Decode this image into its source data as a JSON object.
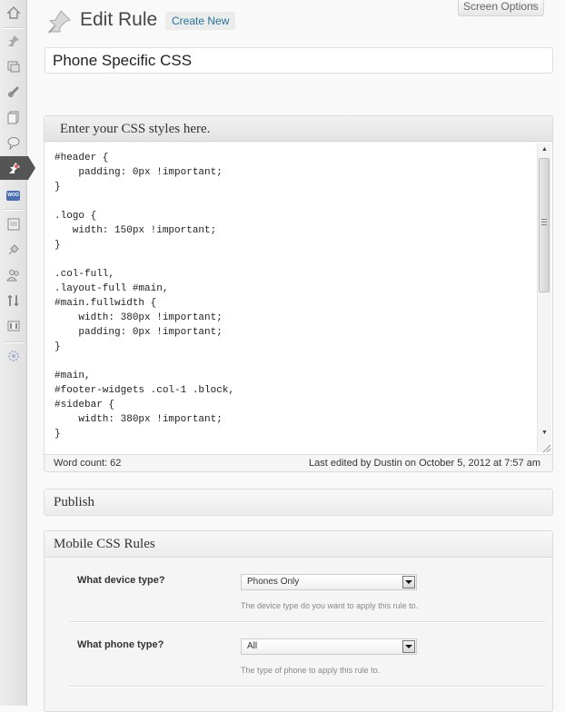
{
  "sidebar": {
    "items": [
      {
        "icon": "dashboard-icon"
      },
      {
        "icon": "posts-pin-icon"
      },
      {
        "icon": "media-icon"
      },
      {
        "icon": "links-icon"
      },
      {
        "icon": "pages-icon"
      },
      {
        "icon": "comments-icon"
      },
      {
        "icon": "mobile-css-pin-icon",
        "active": true
      },
      {
        "icon": "woo-icon",
        "label": "WOO"
      },
      {
        "icon": "appearance-icon"
      },
      {
        "icon": "plugins-icon"
      },
      {
        "icon": "users-icon"
      },
      {
        "icon": "tools-icon"
      },
      {
        "icon": "settings-icon"
      },
      {
        "icon": "collapse-gear-icon"
      }
    ]
  },
  "header": {
    "title": "Edit Rule",
    "create_new": "Create New",
    "screen_options": "Screen Options",
    "screen_options_arrow": "▼"
  },
  "post_title": "Phone Specific CSS",
  "editor": {
    "heading": "Enter your CSS styles here.",
    "code": "#header {\n    padding: 0px !important;\n}\n\n.logo {\n   width: 150px !important;\n}\n\n.col-full,\n.layout-full #main,\n#main.fullwidth {\n    width: 380px !important;\n    padding: 0px !important;\n}\n\n#main,\n#footer-widgets .col-1 .block,\n#sidebar {\n    width: 380px !important;\n}",
    "word_count": "Word count: 62",
    "last_edited": "Last edited by Dustin on October 5, 2012 at 7:57 am",
    "scroll_up": "▲",
    "scroll_down": "▼"
  },
  "publish": {
    "heading": "Publish"
  },
  "mobile_rules": {
    "heading": "Mobile CSS Rules",
    "fields": [
      {
        "label": "What device type?",
        "value": "Phones Only",
        "help": "The device type do you want to apply this rule to."
      },
      {
        "label": "What phone type?",
        "value": "All",
        "help": "The type of phone to apply this rule to."
      }
    ]
  },
  "colors": {
    "link": "#21759b",
    "active_menu": "#555555",
    "sidebar_bg": "#e6e6e6"
  }
}
